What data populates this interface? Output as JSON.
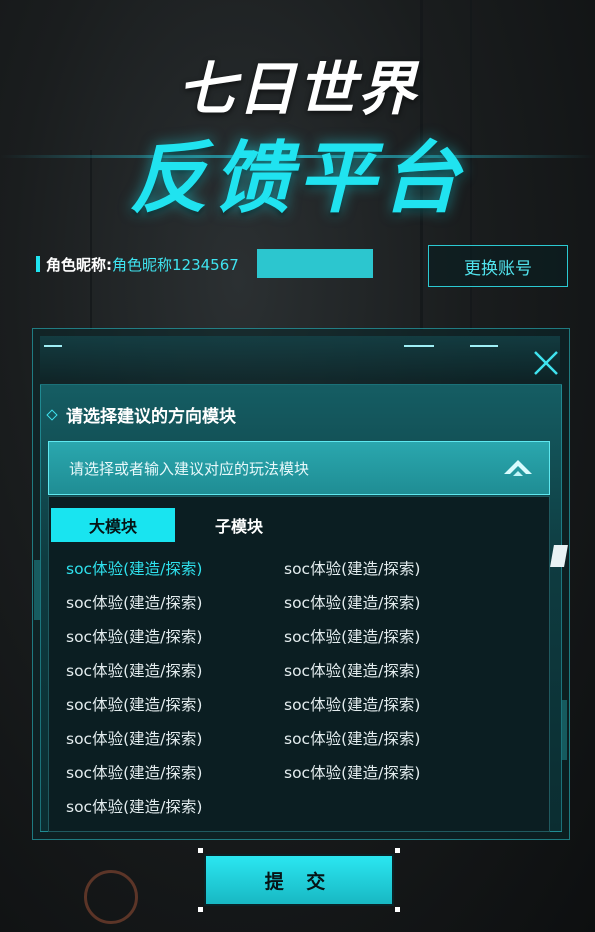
{
  "header": {
    "title_line1": "七日世界",
    "title_line2": "反馈平台"
  },
  "account": {
    "label": "角色昵称:",
    "name": "角色昵称1234567",
    "switch_button": "更换账号"
  },
  "panel": {
    "section_title": "请选择建议的方向模块",
    "dropdown_placeholder": "请选择或者输入建议对应的玩法模块",
    "tabs": [
      {
        "label": "大模块",
        "active": true
      },
      {
        "label": "子模块",
        "active": false
      }
    ],
    "options_left": [
      "soc体验(建造/探索)",
      "soc体验(建造/探索)",
      "soc体验(建造/探索)",
      "soc体验(建造/探索)",
      "soc体验(建造/探索)",
      "soc体验(建造/探索)",
      "soc体验(建造/探索)",
      "soc体验(建造/探索)"
    ],
    "options_right": [
      "soc体验(建造/探索)",
      "soc体验(建造/探索)",
      "soc体验(建造/探索)",
      "soc体验(建造/探索)",
      "soc体验(建造/探索)",
      "soc体验(建造/探索)",
      "soc体验(建造/探索)"
    ]
  },
  "submit_button": "提 交",
  "colors": {
    "accent": "#20e3f0",
    "active_option": "#2fe0ec",
    "panel_bg": "#0b1e22"
  },
  "icons": {
    "close": "close-icon",
    "dropdown": "chevron-up-icon",
    "bullet": "diamond-icon"
  }
}
